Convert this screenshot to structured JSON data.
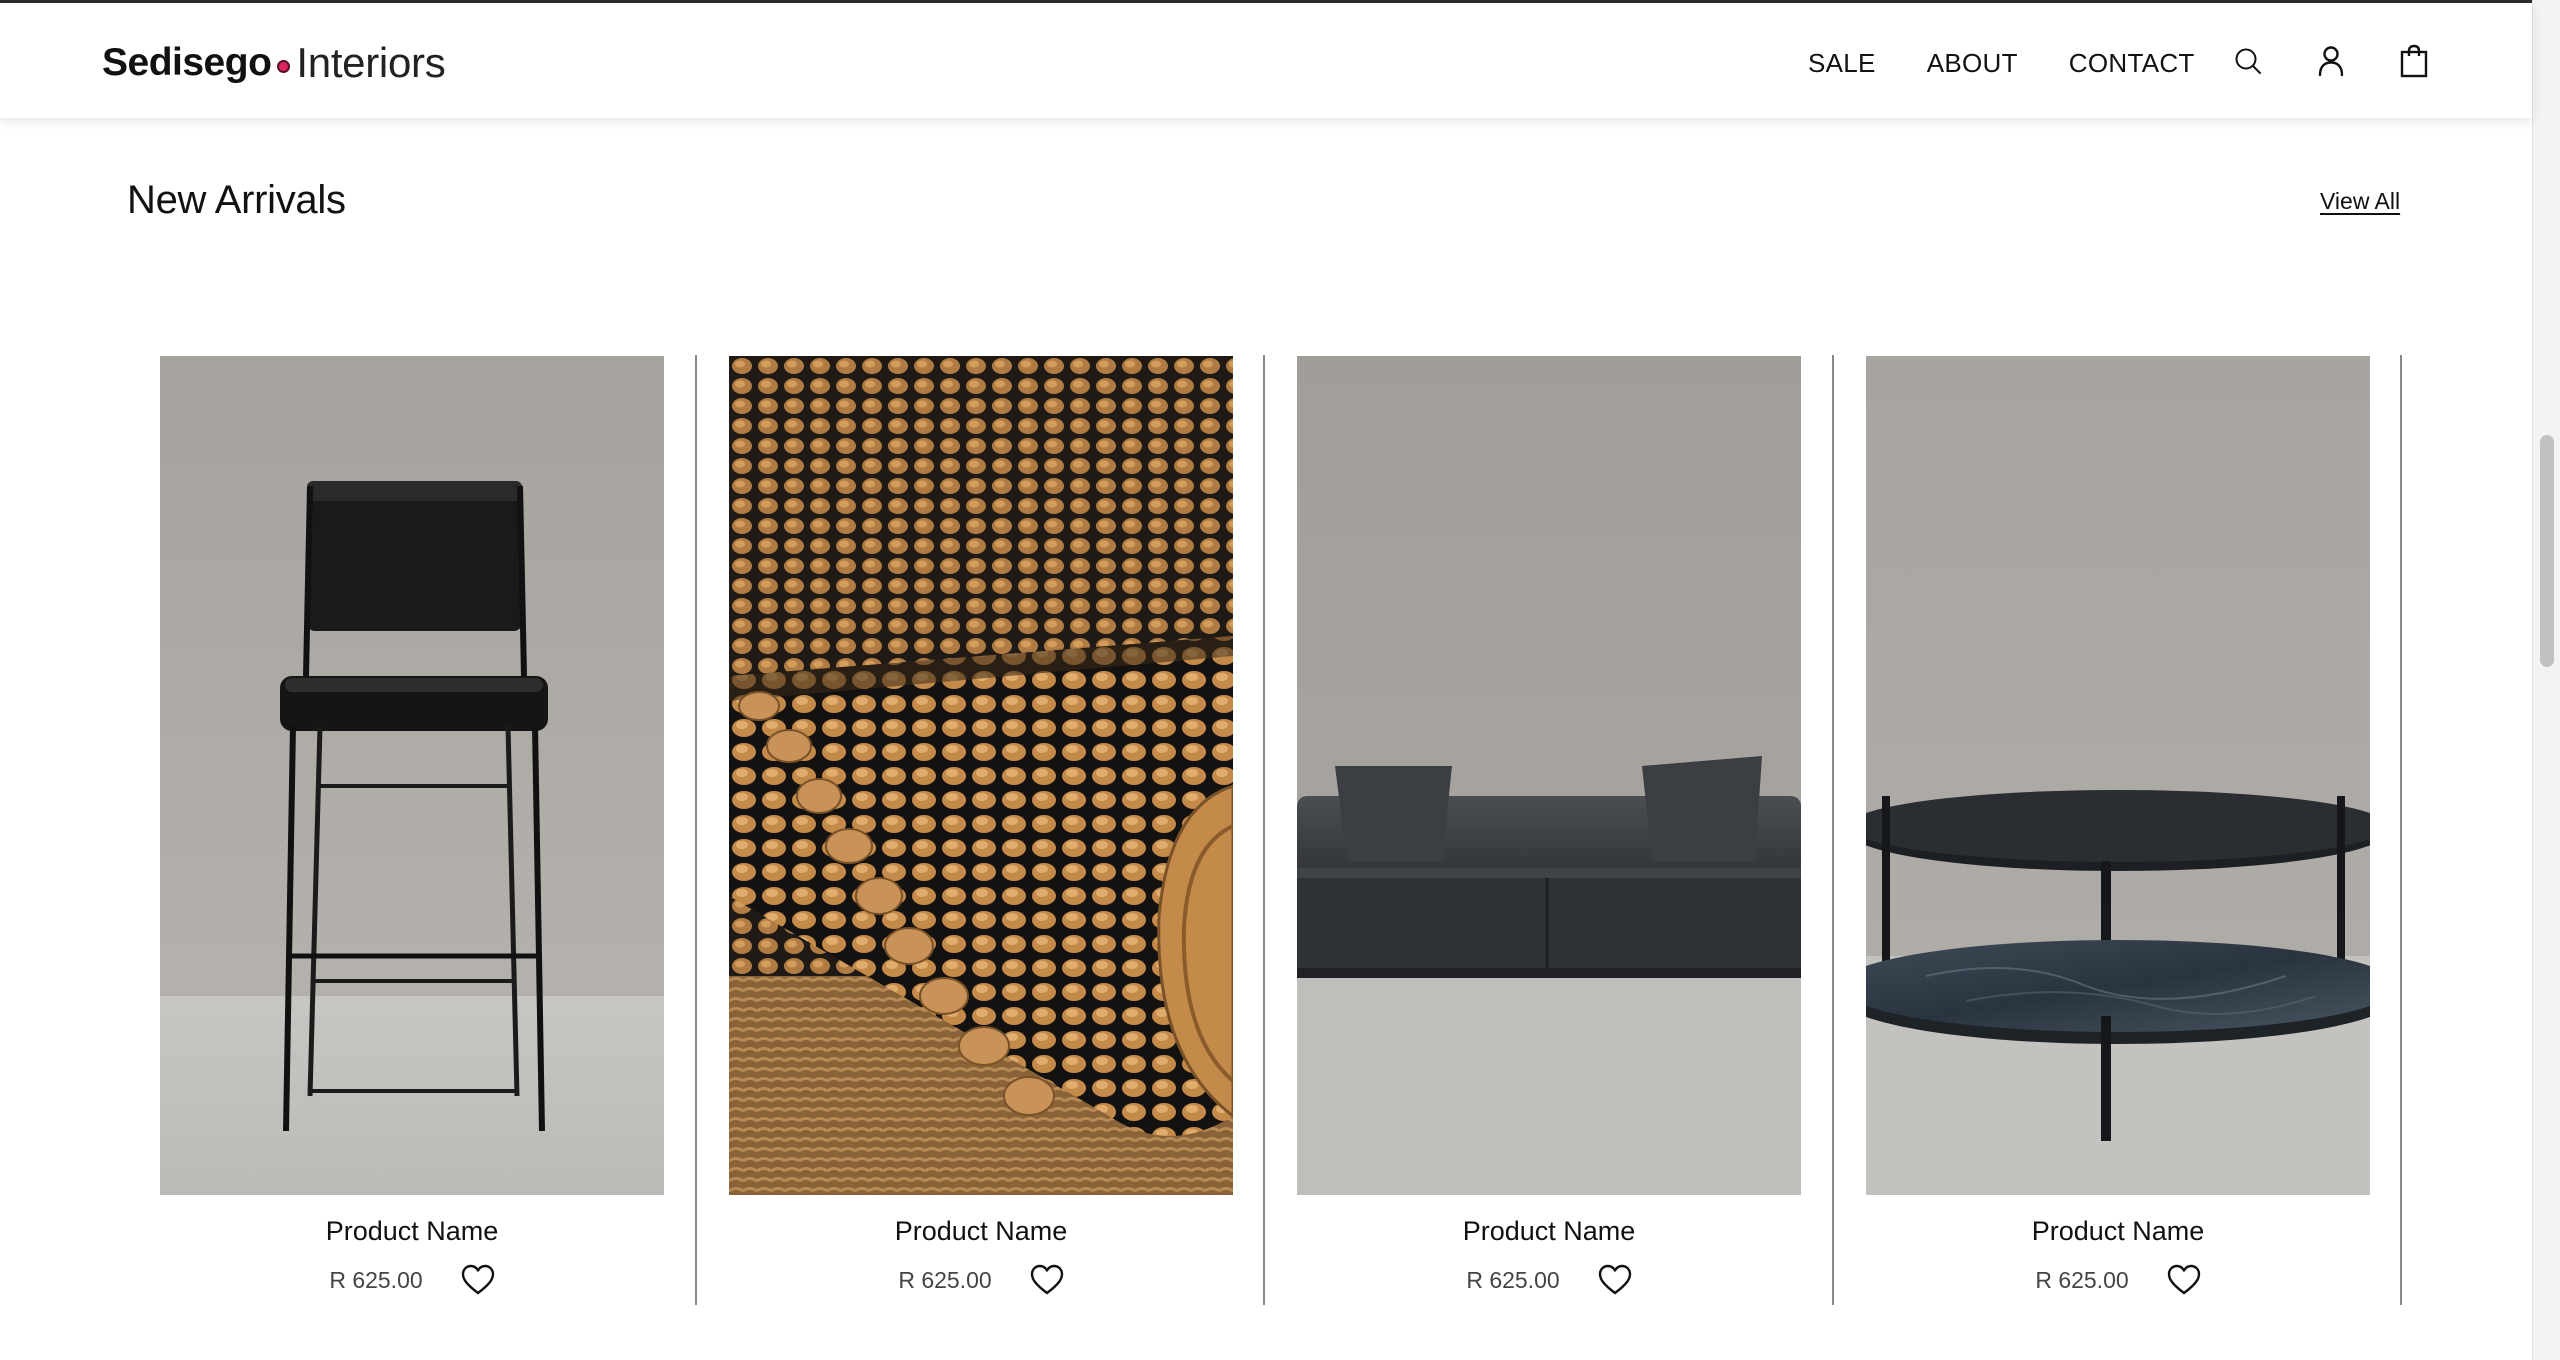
{
  "header": {
    "logo_main": "Sedisego",
    "logo_sub": "Interiors",
    "nav": [
      {
        "label": "SALE"
      },
      {
        "label": "ABOUT"
      },
      {
        "label": "CONTACT"
      }
    ],
    "icons": [
      "search-icon",
      "account-icon",
      "shopping-bag-icon"
    ]
  },
  "section": {
    "title": "New Arrivals",
    "view_all": "View All"
  },
  "products": [
    {
      "name": "Product Name",
      "price": "R 625.00",
      "image": "bar-stool",
      "wishlist_icon": "heart-icon"
    },
    {
      "name": "Product Name",
      "price": "R 625.00",
      "image": "woven-rug",
      "wishlist_icon": "heart-icon"
    },
    {
      "name": "Product Name",
      "price": "R 625.00",
      "image": "leather-sofa",
      "wishlist_icon": "heart-icon"
    },
    {
      "name": "Product Name",
      "price": "R 625.00",
      "image": "round-coffee-table",
      "wishlist_icon": "heart-icon"
    }
  ],
  "colors": {
    "accent_dot": "#d9265b",
    "text": "#111111",
    "price": "#444444",
    "divider": "#8a8a8a"
  }
}
